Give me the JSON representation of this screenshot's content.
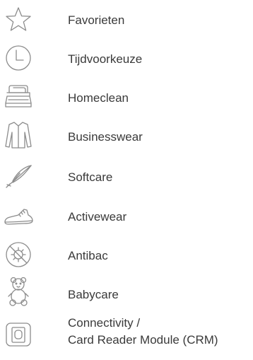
{
  "menu": {
    "items": [
      {
        "label": "Favorieten",
        "icon": "star-icon"
      },
      {
        "label": "Tijdvoorkeuze",
        "icon": "clock-icon"
      },
      {
        "label": "Homeclean",
        "icon": "folded-linen-icon"
      },
      {
        "label": "Businesswear",
        "icon": "shirt-icon"
      },
      {
        "label": "Softcare",
        "icon": "feather-icon"
      },
      {
        "label": "Activewear",
        "icon": "sneaker-icon"
      },
      {
        "label": "Antibac",
        "icon": "antibacterial-icon"
      },
      {
        "label": "Babycare",
        "icon": "teddy-bear-icon"
      },
      {
        "label_line1": "Connectivity /",
        "label_line2": "Card Reader Module (CRM)",
        "icon": "card-reader-icon"
      }
    ]
  },
  "colors": {
    "text": "#3a3a3a",
    "icon_stroke": "#8c8c8c",
    "background": "#ffffff"
  }
}
